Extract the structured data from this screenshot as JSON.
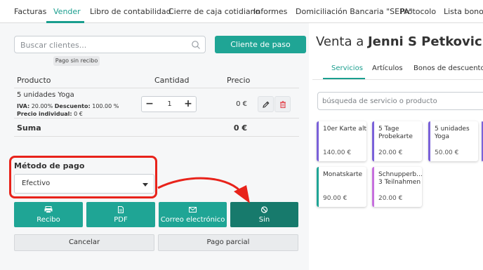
{
  "nav": {
    "tabs": [
      {
        "label": "Facturas"
      },
      {
        "label": "Vender"
      },
      {
        "label": "Libro de contabilidad"
      },
      {
        "label": "Cierre de caja cotidiano"
      },
      {
        "label": "Informes"
      },
      {
        "label": "Domiciliación Bancaria \"SEPA\""
      },
      {
        "label": "Protocolo"
      },
      {
        "label": "Lista bonos d"
      }
    ],
    "active_tab": "Vender",
    "accent_color": "#1a9e8e"
  },
  "left": {
    "search": {
      "placeholder": "Buscar clientes..."
    },
    "tooltip": "Pago sin recibo",
    "walkin_button": "Cliente de paso",
    "table": {
      "headers": {
        "product": "Producto",
        "quantity": "Cantidad",
        "price": "Precio"
      },
      "rows": [
        {
          "name": "5 unidades Yoga",
          "detail_iva_label": "IVA:",
          "detail_iva": "20.00%",
          "detail_discount_label": "Descuento:",
          "detail_discount": "100.00 %",
          "detail_unit_label": "Precio individual:",
          "detail_unit": "0 €",
          "quantity": "1",
          "price": "0 €"
        }
      ],
      "sum_label": "Suma",
      "sum_value": "0 €"
    },
    "payment": {
      "label": "Método de pago",
      "selected": "Efectivo"
    },
    "pay_buttons": [
      {
        "label": "Recibo",
        "icon": "print-icon"
      },
      {
        "label": "PDF",
        "icon": "file-icon"
      },
      {
        "label": "Correo electrónico",
        "icon": "envelope-icon"
      },
      {
        "label": "Sin",
        "icon": "ban-icon"
      }
    ],
    "cancel_button": "Cancelar",
    "partial_button": "Pago parcial"
  },
  "right": {
    "title_prefix": "Venta a",
    "customer": "Jenni S Petkovic",
    "tabs": [
      "Servicios",
      "Artículos",
      "Bonos de descuento"
    ],
    "search_placeholder": "búsqueda de servicio o producto",
    "cards": [
      {
        "name": "10er Karte alt",
        "price": "140.00 €"
      },
      {
        "name": "5 Tage Probekarte",
        "price": "20.00 €"
      },
      {
        "name": "5 unidades Yoga",
        "price": "50.00 €"
      },
      {
        "name": "Monatskarte",
        "price": "90.00 €"
      },
      {
        "name": "Schnupperb... 3 Teilnahmen",
        "price": "20.00 €"
      }
    ]
  },
  "annotation": {
    "highlight_color": "#e8231b"
  }
}
